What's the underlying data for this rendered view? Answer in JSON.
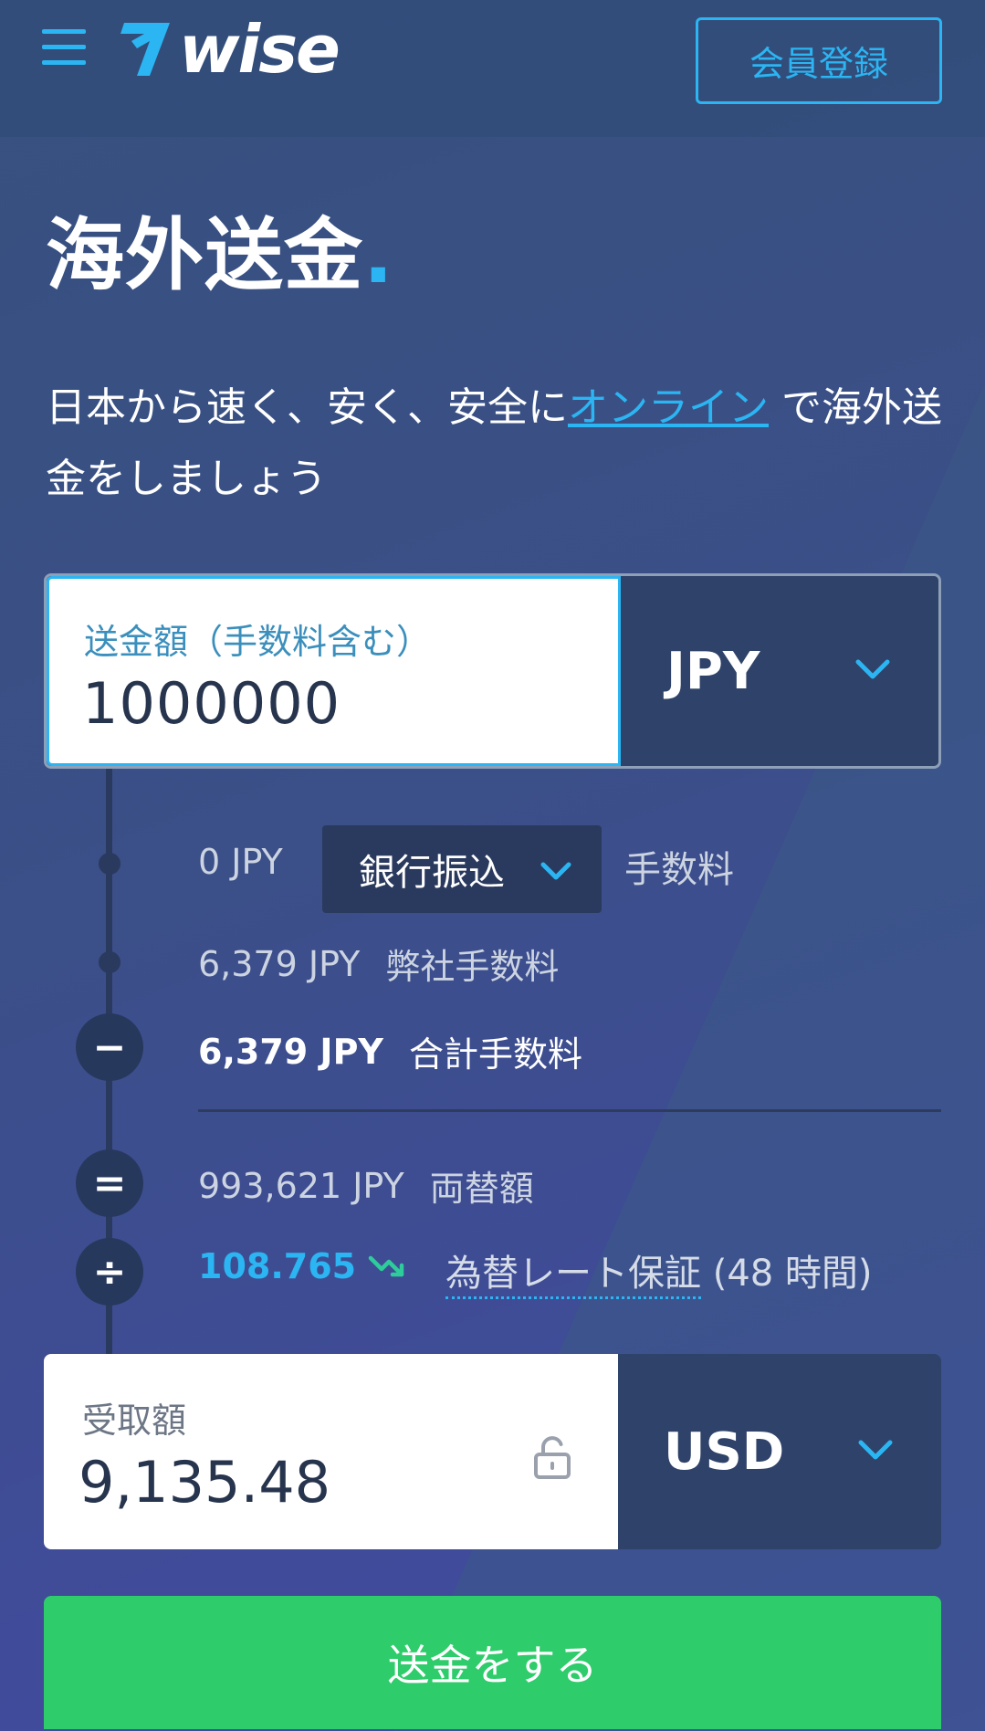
{
  "header": {
    "logo_text": "wise",
    "signup_label": "会員登録"
  },
  "hero": {
    "title": "海外送金",
    "title_dot": ".",
    "subtitle_before": "日本から速く、安く、安全に",
    "subtitle_link": "オンライン",
    "subtitle_after": " で海外送金をしましょう"
  },
  "send": {
    "label": "送金額（手数料含む）",
    "value": "1000000",
    "currency": "JPY"
  },
  "fees": {
    "transfer_fee_amount": "0 JPY",
    "transfer_method": "銀行振込",
    "transfer_fee_label": "手数料",
    "our_fee_amount": "6,379 JPY",
    "our_fee_label": "弊社手数料",
    "total_fee_amount": "6,379 JPY",
    "total_fee_label": "合計手数料",
    "converted_amount": "993,621 JPY",
    "converted_label": "両替額",
    "rate": "108.765",
    "rate_guarantee_link": "為替レート保証",
    "rate_guarantee_duration": " (48 時間)",
    "minus_symbol": "−",
    "equals_symbol": "=",
    "divide_symbol": "÷"
  },
  "receive": {
    "label": "受取額",
    "value": "9,135.48",
    "currency": "USD"
  },
  "cta": {
    "send_label": "送金をする"
  },
  "colors": {
    "accent": "#2bb5f2",
    "button_green": "#2ecc6b",
    "panel_dark": "#2f4269"
  },
  "icons": {
    "menu": "hamburger-menu-icon",
    "logo": "wise-logo-icon",
    "chevron": "chevron-down-icon",
    "lock": "unlock-icon",
    "trend": "trend-down-icon"
  }
}
